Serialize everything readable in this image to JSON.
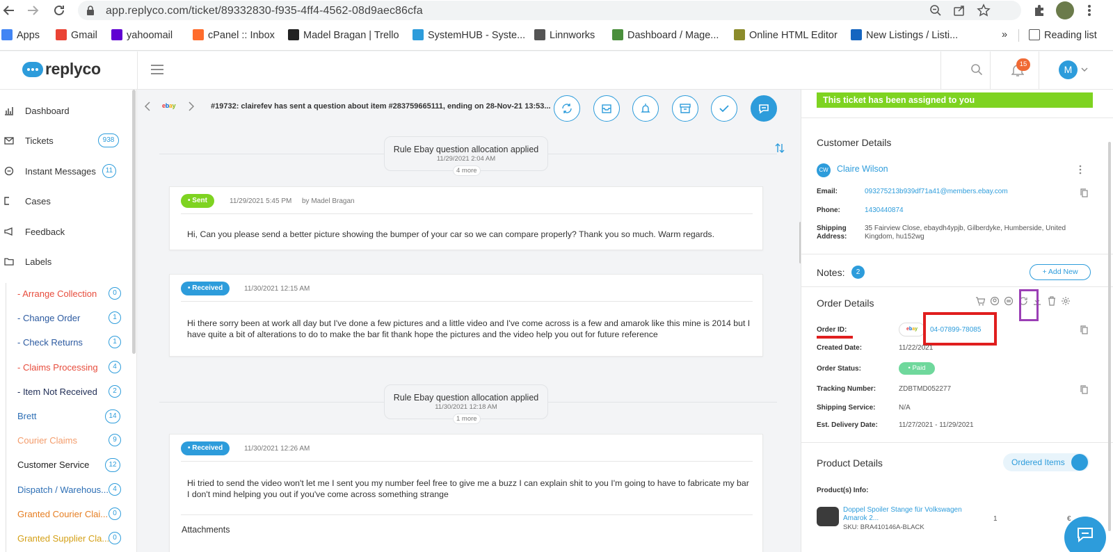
{
  "browser": {
    "url": "app.replyco.com/ticket/89332830-f935-4ff4-4562-08d9aec86cfa",
    "bookmarks": [
      {
        "label": "Apps",
        "icon": "apps-grid-icon",
        "color": "#4285f4"
      },
      {
        "label": "Gmail",
        "icon": "gmail-icon",
        "color": "#ea4335"
      },
      {
        "label": "yahoomail",
        "icon": "yahoo-mail-icon",
        "color": "#6001d2"
      },
      {
        "label": "cPanel :: Inbox",
        "icon": "cpanel-icon",
        "color": "#ff6c2c"
      },
      {
        "label": "Madel Bragan | Trello",
        "icon": "trello-icon",
        "color": "#222222"
      },
      {
        "label": "SystemHUB - Syste...",
        "icon": "systemhub-icon",
        "color": "#2d9cdb"
      },
      {
        "label": "Linnworks",
        "icon": "linnworks-icon",
        "color": "#555555"
      },
      {
        "label": "Dashboard / Mage...",
        "icon": "magento-icon",
        "color": "#4a8f3c"
      },
      {
        "label": "Online HTML Editor",
        "icon": "html-editor-icon",
        "color": "#8b8b2b"
      },
      {
        "label": "New Listings / Listi...",
        "icon": "listings-icon",
        "color": "#1565c0"
      }
    ],
    "more_label": "»",
    "reading_list": "Reading list"
  },
  "app": {
    "logo_text": "replyco",
    "notification_count": "15",
    "avatar_initial": "M"
  },
  "sidebar": {
    "nav": [
      {
        "label": "Dashboard",
        "icon": "bar-chart-icon",
        "count": ""
      },
      {
        "label": "Tickets",
        "icon": "envelope-icon",
        "count": "938"
      },
      {
        "label": "Instant Messages",
        "icon": "chat-bubble-icon",
        "count": "11"
      },
      {
        "label": "Cases",
        "icon": "cases-icon",
        "count": ""
      },
      {
        "label": "Feedback",
        "icon": "megaphone-icon",
        "count": ""
      },
      {
        "label": "Labels",
        "icon": "folder-icon",
        "count": ""
      }
    ],
    "labels": [
      {
        "label": "- Arrange Collection",
        "count": "0",
        "color": "#e74c3c"
      },
      {
        "label": "- Change Order",
        "count": "1",
        "color": "#2c5aa0"
      },
      {
        "label": "- Check Returns",
        "count": "1",
        "color": "#2c5aa0"
      },
      {
        "label": "- Claims Processing",
        "count": "4",
        "color": "#e74c3c"
      },
      {
        "label": "- Item Not Received",
        "count": "2",
        "color": "#1f2d55"
      },
      {
        "label": "Brett",
        "count": "14",
        "color": "#2d6fb5"
      },
      {
        "label": "Courier Claims",
        "count": "9",
        "color": "#f39c6b"
      },
      {
        "label": "Customer Service",
        "count": "12",
        "color": "#222222"
      },
      {
        "label": "Dispatch / Warehous...",
        "count": "4",
        "color": "#2d6fb5"
      },
      {
        "label": "Granted Courier Clai...",
        "count": "0",
        "color": "#e67e22"
      },
      {
        "label": "Granted Supplier Cla...",
        "count": "0",
        "color": "#d4a017"
      }
    ]
  },
  "conversation": {
    "channel": "ebay",
    "title": "#19732: clairefev has sent a question about item #283759665111, ending on 28-Nov-21 13:53...",
    "actions": [
      {
        "name": "refresh-icon"
      },
      {
        "name": "mail-icon"
      },
      {
        "name": "bell-icon"
      },
      {
        "name": "archive-icon"
      },
      {
        "name": "check-icon"
      },
      {
        "name": "reply-chat-icon"
      }
    ],
    "system_events": [
      {
        "text": "Rule Ebay question allocation applied",
        "time": "11/29/2021 2:04 AM",
        "more": "4 more"
      },
      {
        "text": "Rule Ebay question allocation applied",
        "time": "11/30/2021 12:18 AM",
        "more": "1 more"
      }
    ],
    "messages": [
      {
        "status": "• Sent",
        "status_color": "#7ed321",
        "time": "11/29/2021 5:45 PM",
        "by": "by Madel Bragan",
        "body": "Hi,   Can you please send a better picture showing the bumper of your car so we can compare properly?   Thank you so much.   Warm regards."
      },
      {
        "status": "• Received",
        "status_color": "#2d9cdb",
        "time": "11/30/2021 12:15 AM",
        "by": "",
        "body": "Hi there sorry been at work all day but I've done a few pictures and a little video and I've come across is a few and amarok like this mine is 2014 but I have quite a bit of alterations to do to make the bar fit thank hope the pictures and the video help you out for future reference"
      },
      {
        "status": "• Received",
        "status_color": "#2d9cdb",
        "time": "11/30/2021 12:26 AM",
        "by": "",
        "body": "Hi tried to send the video won't let me I sent you my number feel free to give me a buzz I can explain shit to you I'm going to have to fabricate my bar I don't mind helping you out if you've come across something strange",
        "attachments_label": "Attachments"
      }
    ]
  },
  "panel": {
    "assigned_banner": "This ticket has been assigned to you",
    "customer": {
      "section_title": "Customer Details",
      "initials": "CW",
      "name": "Claire Wilson",
      "email_label": "Email:",
      "email": "093275213b939df71a41@members.ebay.com",
      "phone_label": "Phone:",
      "phone": "1430440874",
      "address_label": "Shipping Address:",
      "address": "35 Fairview Close, ebaydh4ypjb, Gilberdyke, Humberside, United Kingdom, hu152wg"
    },
    "notes": {
      "label": "Notes:",
      "count": "2",
      "add_label": "+ Add New"
    },
    "order": {
      "section_title": "Order Details",
      "order_id_label": "Order ID:",
      "channel_badge": "ebay",
      "order_id": "04-07899-78085",
      "created_label": "Created Date:",
      "created": "11/22/2021",
      "status_label": "Order Status:",
      "status": "• Paid",
      "tracking_label": "Tracking Number:",
      "tracking": "ZDBTMD052277",
      "shipping_label": "Shipping Service:",
      "shipping": "N/A",
      "delivery_label": "Est. Delivery Date:",
      "delivery": "11/27/2021 - 11/29/2021",
      "tools": [
        "cart-icon",
        "person-search-icon",
        "exchange-icon",
        "sync-icon",
        "download-icon",
        "trash-icon",
        "settings-icon"
      ]
    },
    "product": {
      "section_title": "Product Details",
      "toggle_label": "Ordered Items",
      "info_label": "Product(s) Info:",
      "product_name": "Doppel Spoiler Stange für Volkswagen Amarok 2...",
      "sku": "SKU: BRA410146A-BLACK",
      "qty": "1",
      "price": "€"
    }
  },
  "colors": {
    "accent": "#2d9cdb",
    "sent": "#7ed321",
    "highlight_red": "#e01e1e",
    "highlight_purple": "#9b3fb5"
  }
}
